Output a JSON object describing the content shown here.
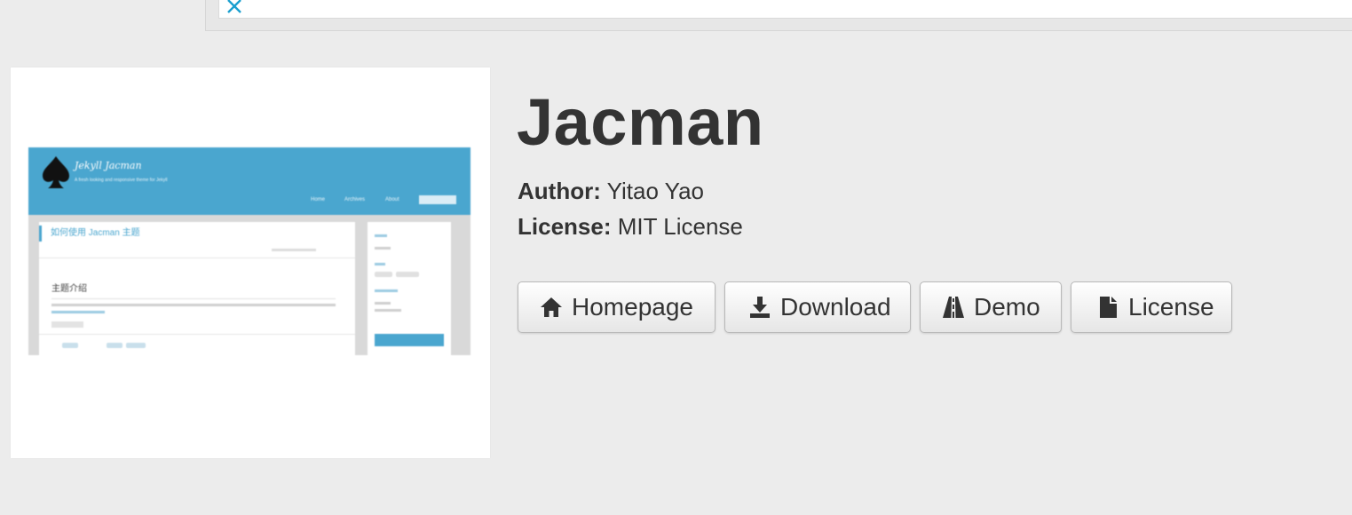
{
  "top_bar": {
    "close_icon": "close-icon",
    "accent": "#1a9fcf"
  },
  "thumbnail": {
    "site_name": "Jekyll Jacman",
    "tagline": "A fresh looking and responsive theme for Jekyll",
    "nav": [
      "Home",
      "Archives",
      "About"
    ],
    "post_title": "如何使用 Jacman 主题",
    "section_heading": "主题介绍",
    "header_color": "#4aa6cf"
  },
  "theme": {
    "name": "Jacman",
    "author_label": "Author:",
    "author": "Yitao Yao",
    "license_label": "License:",
    "license": "MIT License"
  },
  "buttons": [
    {
      "label": "Homepage",
      "icon": "home-icon"
    },
    {
      "label": "Download",
      "icon": "download-icon"
    },
    {
      "label": "Demo",
      "icon": "road-icon"
    },
    {
      "label": "License",
      "icon": "file-icon"
    }
  ]
}
